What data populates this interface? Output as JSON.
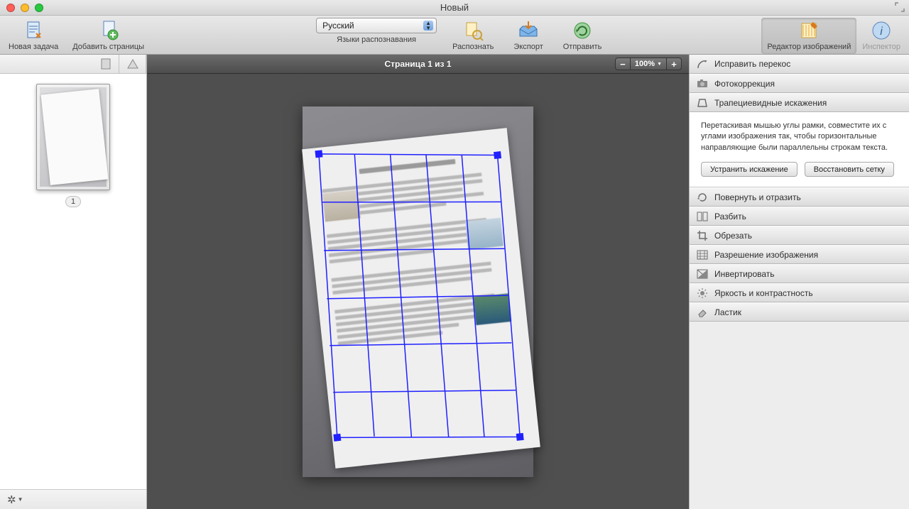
{
  "window": {
    "title": "Новый"
  },
  "toolbar": {
    "new_task": "Новая задача",
    "add_pages": "Добавить страницы",
    "lang_caption": "Языки распознавания",
    "lang_value": "Русский",
    "recognize": "Распознать",
    "export": "Экспорт",
    "send": "Отправить",
    "image_editor": "Редактор изображений",
    "inspector": "Инспектор"
  },
  "canvas": {
    "page_info": "Страница 1 из 1",
    "zoom": "100%",
    "minus": "−",
    "plus": "+"
  },
  "thumb": {
    "number": "1"
  },
  "side": {
    "deskew": "Исправить перекос",
    "photo_correction": "Фотокоррекция",
    "trapezoid": "Трапециевидные искажения",
    "trapezoid_help": "Перетаскивая мышью углы рамки, совместите их с углами изображения так, чтобы горизонтальные направляющие были параллельны строкам текста.",
    "btn_fix": "Устранить искажение",
    "btn_reset": "Восстановить сетку",
    "rotate": "Повернуть и отразить",
    "split": "Разбить",
    "crop": "Обрезать",
    "resolution": "Разрешение изображения",
    "invert": "Инвертировать",
    "brightness": "Яркость и контрастность",
    "eraser": "Ластик"
  }
}
